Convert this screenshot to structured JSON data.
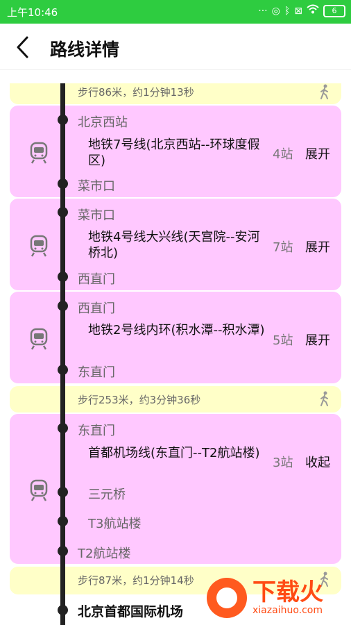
{
  "status_bar": {
    "time": "上午10:46",
    "battery": "6"
  },
  "header": {
    "title": "路线详情"
  },
  "segments": [
    {
      "type": "walk",
      "text": "步行86米，约1分钟13秒"
    },
    {
      "type": "transit",
      "from": "北京西站",
      "line": "地铁7号线(北京西站--环球度假区)",
      "stops": "4站",
      "toggle": "展开",
      "to": "菜市口"
    },
    {
      "type": "transit",
      "from": "菜市口",
      "line": "地铁4号线大兴线(天宫院--安河桥北)",
      "stops": "7站",
      "toggle": "展开",
      "to": "西直门"
    },
    {
      "type": "transit",
      "from": "西直门",
      "line": "地铁2号线内环(积水潭--积水潭)",
      "stops": "5站",
      "toggle": "展开",
      "to": "东直门"
    },
    {
      "type": "walk",
      "text": "步行253米，约3分钟36秒"
    },
    {
      "type": "transit",
      "from": "东直门",
      "line": "首都机场线(东直门--T2航站楼)",
      "stops": "3站",
      "toggle": "收起",
      "intermediate": [
        "三元桥",
        "T3航站楼"
      ],
      "to": "T2航站楼"
    },
    {
      "type": "walk",
      "text": "步行87米，约1分钟14秒"
    }
  ],
  "destination": "北京首都国际机场",
  "watermark": {
    "cn": "下载火",
    "en": "xiazaihuo.com"
  },
  "colors": {
    "status_bar": "#2ecc40",
    "walk_bg": "#ffffc8",
    "transit_bg": "#ffc8ff"
  }
}
